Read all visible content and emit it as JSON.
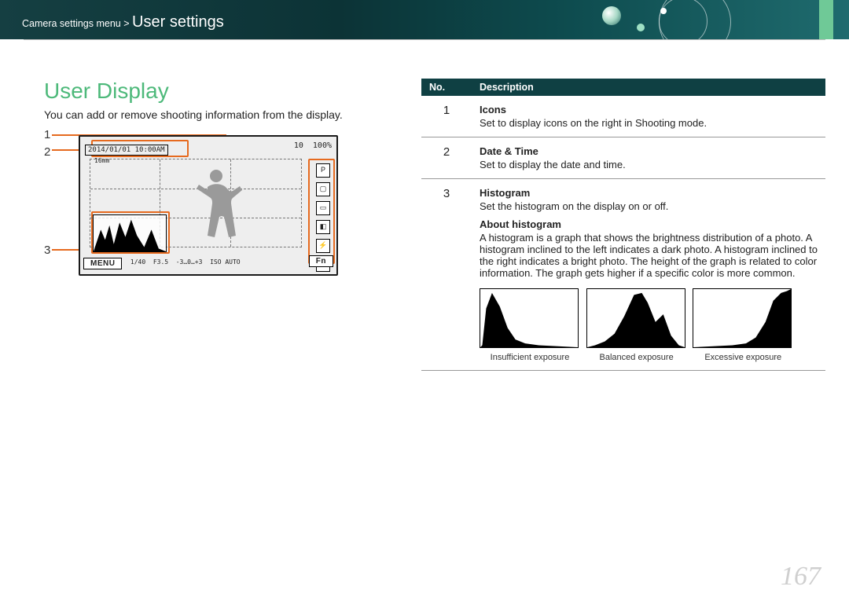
{
  "header": {
    "breadcrumb_root": "Camera settings menu",
    "breadcrumb_section": "User settings"
  },
  "left": {
    "title": "User Display",
    "intro": "You can add or remove shooting information from the display.",
    "callouts": [
      "1",
      "2",
      "3"
    ],
    "lcd": {
      "datetime": "2014/01/01 10:00AM",
      "lens": "16mm",
      "shots": "10",
      "battery": "100%",
      "menu": "MENU",
      "fn": "Fn",
      "shutter": "1/40",
      "aperture": "F3.5",
      "ev": "-3…0…+3",
      "iso": "ISO AUTO"
    }
  },
  "table": {
    "headers": [
      "No.",
      "Description"
    ],
    "rows": [
      {
        "no": "1",
        "title": "Icons",
        "text": "Set to display icons on the right in Shooting mode."
      },
      {
        "no": "2",
        "title": "Date & Time",
        "text": "Set to display the date and time."
      },
      {
        "no": "3",
        "title": "Histogram",
        "text": "Set the histogram on the display on or off.",
        "sub_title": "About histogram",
        "sub_text": "A histogram is a graph that shows the brightness distribution of a photo. A histogram inclined to the left indicates a dark photo. A histogram inclined to the right indicates a bright photo. The height of the graph is related to color information. The graph gets higher if a specific color is more common.",
        "examples": [
          "Insufficient exposure",
          "Balanced exposure",
          "Excessive exposure"
        ]
      }
    ]
  },
  "page_number": "167"
}
